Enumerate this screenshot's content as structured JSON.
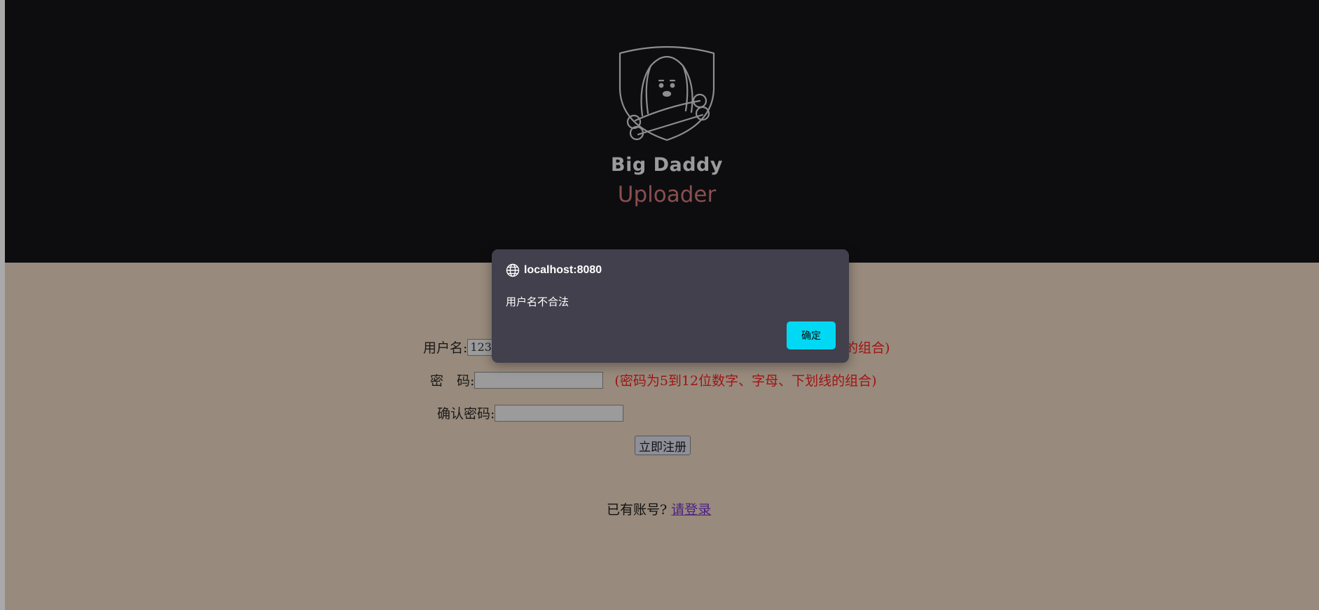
{
  "brand": {
    "name": "Big Daddy",
    "product": "Uploader"
  },
  "form": {
    "username_label": "用户名:",
    "username_value": "123",
    "username_hint": "的组合)",
    "password_label": "密　码:",
    "password_value": "",
    "password_hint": "(密码为5到12位数字、字母、下划线的组合)",
    "confirm_label": "确认密码:",
    "confirm_value": "",
    "submit_label": "立即注册"
  },
  "login": {
    "prompt": "已有账号?",
    "link_label": "请登录"
  },
  "dialog": {
    "origin": "localhost:8080",
    "message": "用户名不合法",
    "ok_label": "确定"
  },
  "colors": {
    "header_bg": "#0d0d10",
    "page_bg": "#988a7c",
    "hint_red": "#a01414",
    "dialog_bg": "#41404c",
    "dialog_button": "#00d8f4",
    "link_purple": "#4b1f86"
  },
  "icons": {
    "dialog_origin_icon": "globe-icon",
    "logo": "dog-with-bone-logo"
  }
}
